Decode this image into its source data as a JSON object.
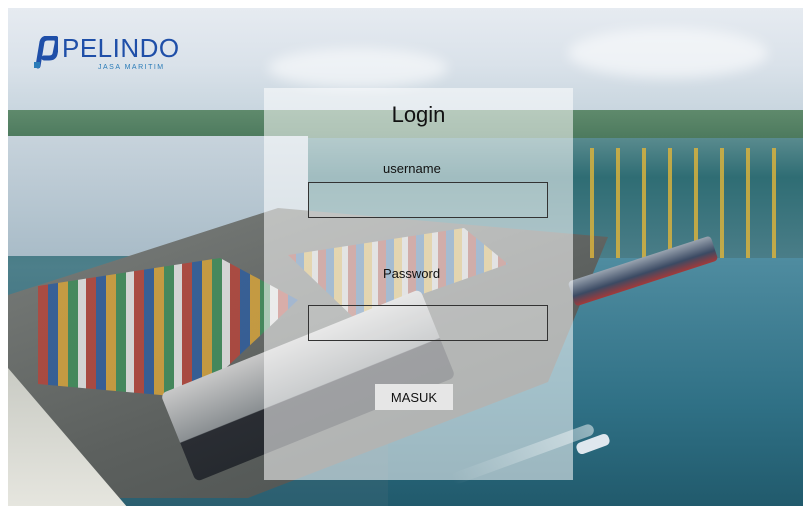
{
  "brand": {
    "name": "PELINDO",
    "subtitle": "JASA MARITIM",
    "color": "#1f4fa8",
    "logo_icon": "pelindo-logo-icon"
  },
  "login": {
    "title": "Login",
    "username_label": "username",
    "username_value": "",
    "password_label": "Password",
    "password_value": "",
    "submit_label": "MASUK"
  },
  "background": {
    "description_icon": "port-photo-background"
  }
}
